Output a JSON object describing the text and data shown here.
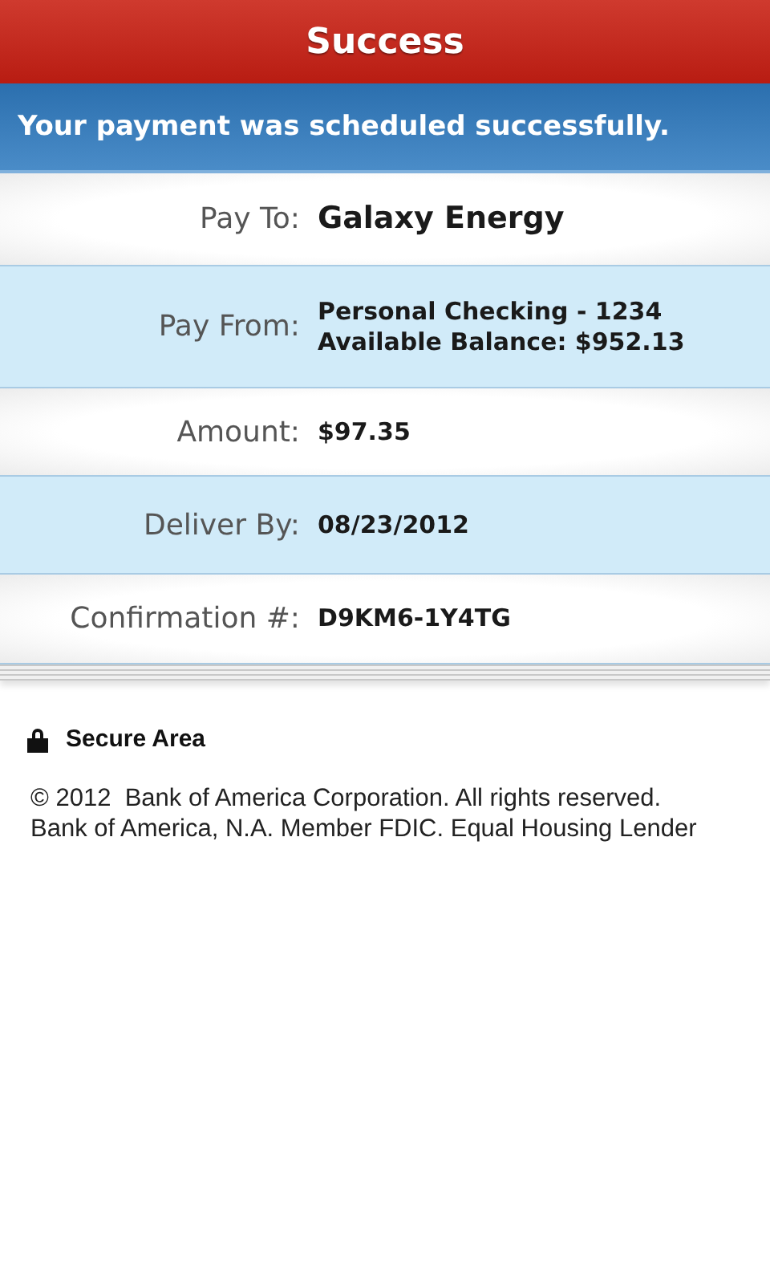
{
  "header": {
    "title": "Success"
  },
  "banner": {
    "message": "Your payment was scheduled successfully."
  },
  "details": [
    {
      "label": "Pay To:",
      "kind": "title",
      "lines": [
        "Galaxy Energy"
      ]
    },
    {
      "label": "Pay From:",
      "kind": "detail",
      "lines": [
        "Personal Checking - 1234",
        "Available Balance: $952.13"
      ]
    },
    {
      "label": "Amount:",
      "kind": "detail",
      "lines": [
        "$97.35"
      ]
    },
    {
      "label": "Deliver By:",
      "kind": "detail",
      "lines": [
        "08/23/2012"
      ]
    },
    {
      "label": "Confirmation #:",
      "kind": "detail",
      "lines": [
        "D9KM6-1Y4TG"
      ]
    }
  ],
  "secure": {
    "label": "Secure Area"
  },
  "footer": {
    "lines": [
      "© 2012  Bank of America Corporation. All rights reserved.",
      "Bank of America, N.A. Member FDIC. Equal Housing Lender"
    ]
  }
}
